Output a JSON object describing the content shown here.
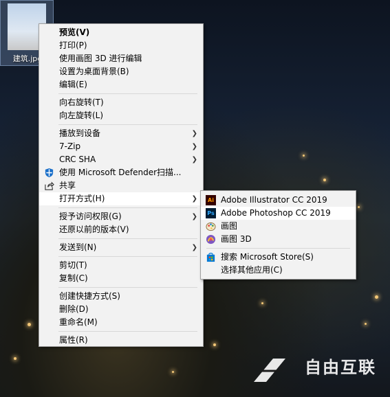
{
  "desktop": {
    "file_label": "建筑.jpg"
  },
  "context_menu": {
    "groups": [
      [
        "预览(V)",
        "打印(P)",
        "使用画图 3D 进行编辑",
        "设置为桌面背景(B)",
        "编辑(E)"
      ],
      [
        "向右旋转(T)",
        "向左旋转(L)"
      ],
      [
        "播放到设备",
        "7-Zip",
        "CRC SHA",
        "使用 Microsoft Defender扫描...",
        "共享",
        "打开方式(H)"
      ],
      [
        "授予访问权限(G)",
        "还原以前的版本(V)"
      ],
      [
        "发送到(N)"
      ],
      [
        "剪切(T)",
        "复制(C)"
      ],
      [
        "创建快捷方式(S)",
        "删除(D)",
        "重命名(M)"
      ],
      [
        "属性(R)"
      ]
    ]
  },
  "open_with": {
    "apps": [
      "Adobe Illustrator CC 2019",
      "Adobe Photoshop CC 2019",
      "画图",
      "画图 3D"
    ],
    "store": "搜索 Microsoft Store(S)",
    "choose_other": "选择其他应用(C)"
  },
  "icons": {
    "illustrator": "Ai",
    "photoshop": "Ps"
  },
  "watermark": "自由互联"
}
